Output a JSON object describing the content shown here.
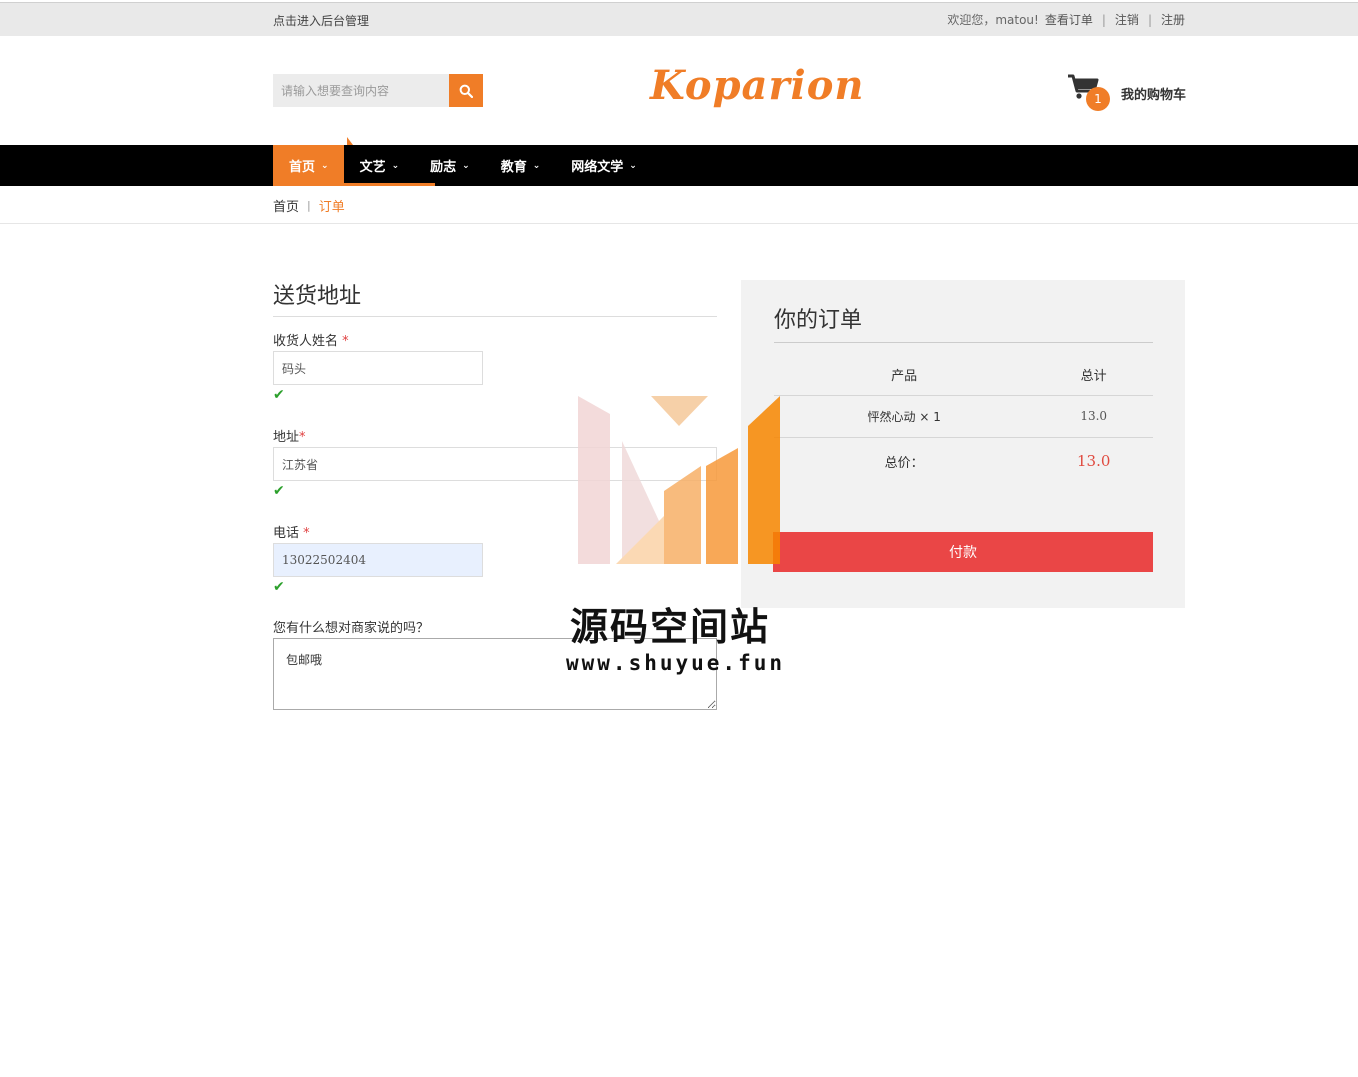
{
  "topbar": {
    "admin_link": "点击进入后台管理",
    "welcome": "欢迎您，matou!",
    "orders_link": "查看订单",
    "logout_link": "注销",
    "register_link": "注册",
    "separator": "|"
  },
  "header": {
    "search_placeholder": "请输入想要查询内容",
    "logo": "Koparion",
    "cart_count": "1",
    "cart_label": "我的购物车"
  },
  "nav": {
    "items": [
      {
        "label": "首页"
      },
      {
        "label": "文艺"
      },
      {
        "label": "励志"
      },
      {
        "label": "教育"
      },
      {
        "label": "网络文学"
      }
    ]
  },
  "breadcrumb": {
    "home": "首页",
    "separator": "|",
    "current": "订单"
  },
  "form": {
    "title": "送货地址",
    "name_label": "收货人姓名",
    "name_value": "码头",
    "address_label": "地址",
    "address_value": "江苏省",
    "phone_label": "电话",
    "phone_value": "13022502404",
    "note_label": "您有什么想对商家说的吗？",
    "note_value": "包邮哦",
    "required_mark": "*"
  },
  "order": {
    "title": "你的订单",
    "col_product": "产品",
    "col_total": "总计",
    "items": [
      {
        "product": "怦然心动 × 1",
        "total": "13.0"
      }
    ],
    "total_label": "总价：",
    "total_value": "13.0",
    "pay_button": "付款"
  },
  "watermark": {
    "title": "源码空间站",
    "url": "www.shuyue.fun"
  },
  "colors": {
    "accent": "#f07d27",
    "pay": "#ea4646",
    "nav_bg": "#000000"
  }
}
